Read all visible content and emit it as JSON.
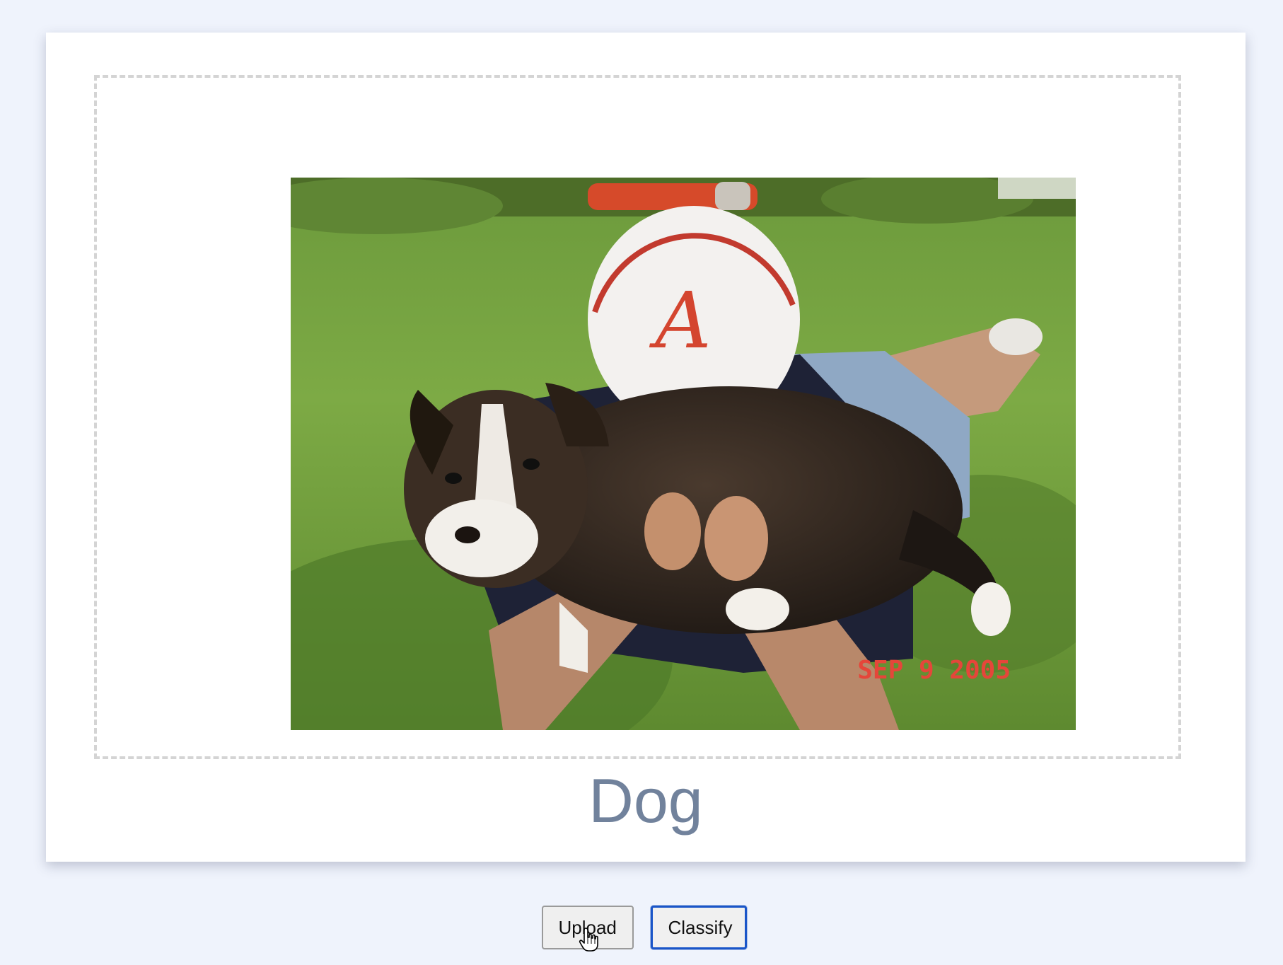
{
  "photo": {
    "alt": "Puppy held up in grass",
    "date_stamp": "SEP  9 2005",
    "cap_logo": "A"
  },
  "result": {
    "label": "Dog"
  },
  "buttons": {
    "upload_label": "Upload",
    "classify_label": "Classify"
  },
  "cursor": {
    "icon": "hand-pointer-icon"
  },
  "colors": {
    "page_background": "#eff3fc",
    "card_background": "#ffffff",
    "result_text": "#71829c",
    "focus_ring": "#1a55c8",
    "dropzone_border": "#d4d4d4"
  }
}
